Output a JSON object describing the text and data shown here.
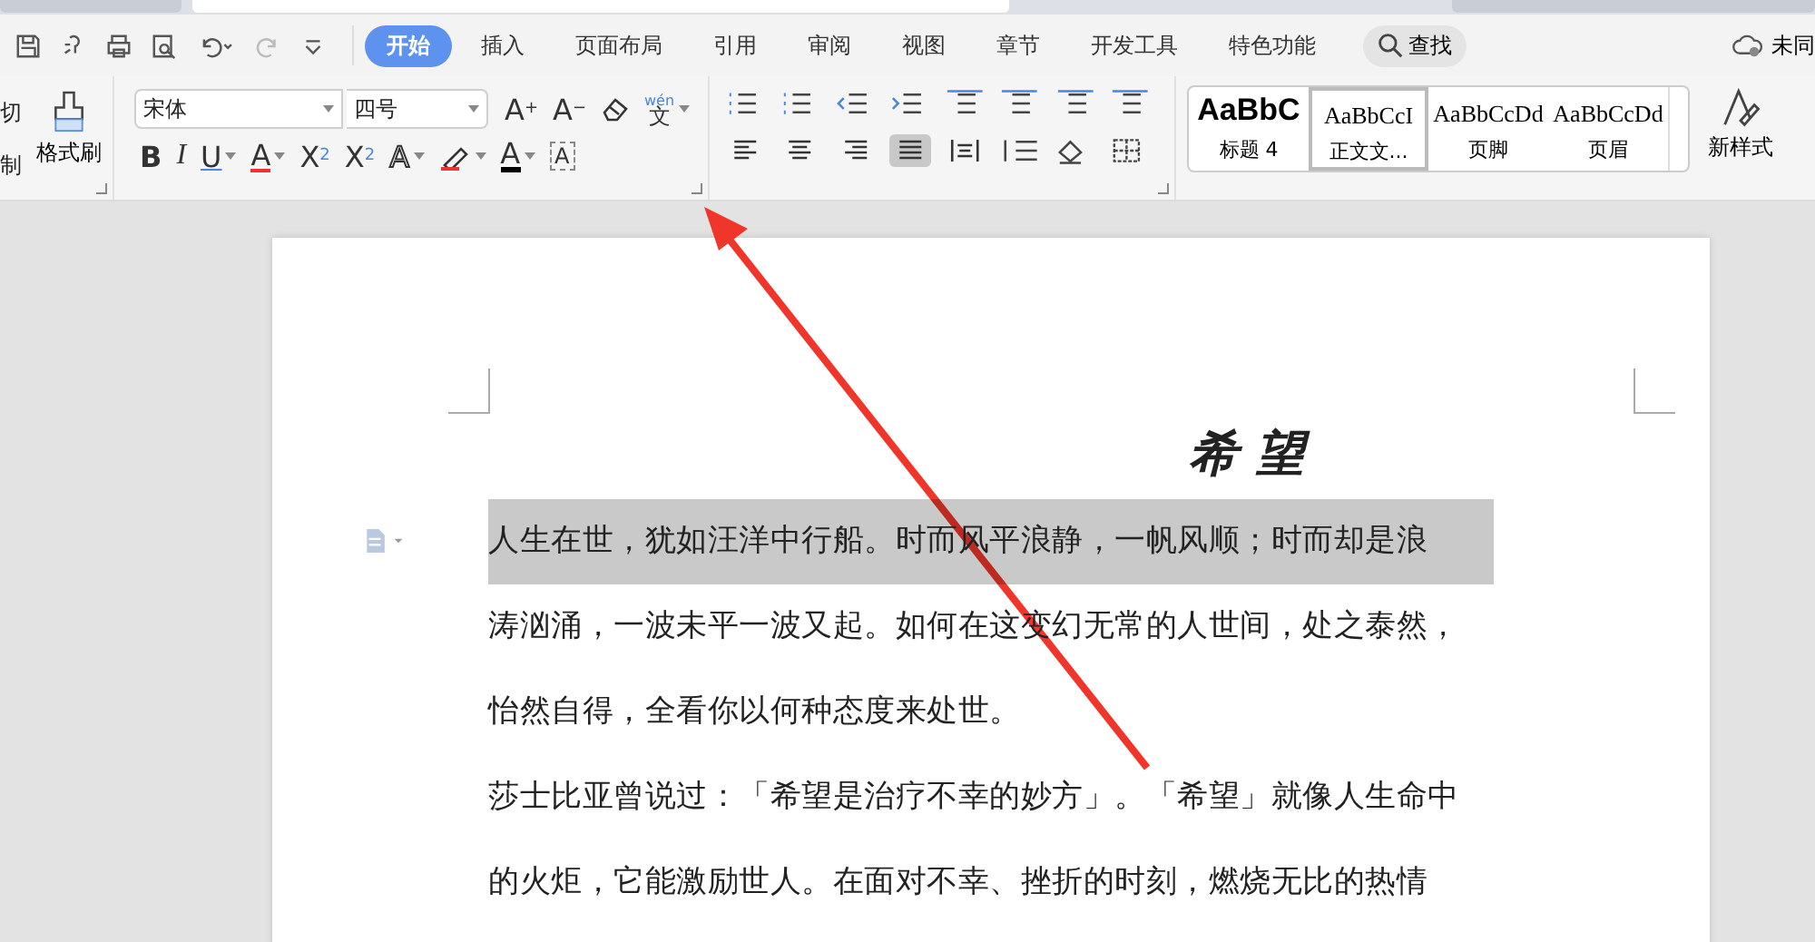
{
  "document_tabs": [
    {
      "selected": false
    },
    {
      "selected": true
    },
    {
      "selected": false
    }
  ],
  "menu_tabs": [
    {
      "label": "开始",
      "selected": true
    },
    {
      "label": "插入",
      "selected": false
    },
    {
      "label": "页面布局",
      "selected": false
    },
    {
      "label": "引用",
      "selected": false
    },
    {
      "label": "审阅",
      "selected": false
    },
    {
      "label": "视图",
      "selected": false
    },
    {
      "label": "章节",
      "selected": false
    },
    {
      "label": "开发工具",
      "selected": false
    },
    {
      "label": "特色功能",
      "selected": false
    }
  ],
  "search": "查找",
  "sync": "未同",
  "clipboard": [
    "切",
    "制"
  ],
  "format_painter": "格式刷",
  "font": {
    "family": "宋体",
    "size": "四号"
  },
  "font_tools_row1": [
    {
      "kind": "grow",
      "glyph": "A",
      "mark": "+"
    },
    {
      "kind": "shrink",
      "glyph": "A",
      "mark": "−"
    },
    {
      "kind": "eraser"
    },
    {
      "kind": "phonetic",
      "glyph": "文",
      "mark": "wén"
    }
  ],
  "font_tools_row2": [
    {
      "kind": "bold",
      "glyph": "B"
    },
    {
      "kind": "italic",
      "glyph": "I"
    },
    {
      "kind": "underline",
      "glyph": "U"
    },
    {
      "kind": "strike",
      "glyph": "A"
    },
    {
      "kind": "superscript",
      "glyph": "X",
      "mark": "2"
    },
    {
      "kind": "subscript",
      "glyph": "X",
      "mark": "2"
    },
    {
      "kind": "outline",
      "glyph": "A"
    },
    {
      "kind": "highlight"
    },
    {
      "kind": "color",
      "glyph": "A"
    },
    {
      "kind": "charborder",
      "glyph": "A"
    }
  ],
  "alignment": [
    {
      "kind": "left",
      "selected": false
    },
    {
      "kind": "center",
      "selected": false
    },
    {
      "kind": "right",
      "selected": false
    },
    {
      "kind": "justify",
      "selected": true
    },
    {
      "kind": "distributed",
      "selected": false
    }
  ],
  "styles": [
    {
      "kind": "heading",
      "preview": "AaBbC",
      "name": "标题 4",
      "selected": false
    },
    {
      "kind": "body",
      "preview": "AaBbCcI",
      "name": "正文文...",
      "selected": true
    },
    {
      "kind": "body",
      "preview": "AaBbCcDd",
      "name": "页脚",
      "selected": false
    },
    {
      "kind": "body",
      "preview": "AaBbCcDd",
      "name": "页眉",
      "selected": false
    }
  ],
  "new_style": "新样式",
  "document": {
    "title": "希 望",
    "lines": [
      {
        "text": "人生在世，犹如汪洋中行船。时而风平浪静，一帆风顺；时而却是浪",
        "highlighted": true
      },
      {
        "text": "涛汹涌，一波未平一波又起。如何在这变幻无常的人世间，处之泰然，",
        "highlighted": false
      },
      {
        "text": "怡然自得，全看你以何种态度来处世。",
        "highlighted": false
      },
      {
        "text": "莎士比亚曾说过：「希望是治疗不幸的妙方」。「希望」就像人生命中",
        "highlighted": false
      },
      {
        "text": "的火炬，它能激励世人。在面对不幸、挫折的时刻，燃烧无比的热情",
        "highlighted": false
      }
    ]
  }
}
